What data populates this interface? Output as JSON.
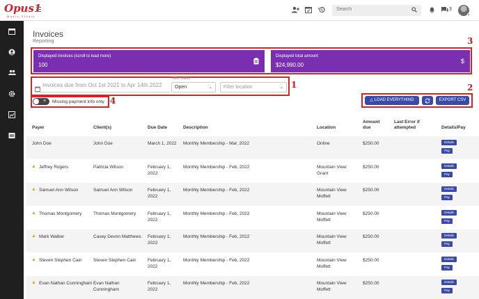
{
  "app": {
    "logo_text": "Opus1",
    "logo_subtitle": "Music Studio"
  },
  "topbar": {
    "search_placeholder": "Search",
    "chat_count": "3",
    "icons": [
      "person-add-icon",
      "calendar-check-icon",
      "history-icon",
      "bell-icon",
      "chat-icon"
    ]
  },
  "sidebar": {
    "icons": [
      "calendar-icon",
      "person-icon",
      "people-icon",
      "gear-icon",
      "chart-icon",
      "report-icon"
    ]
  },
  "page": {
    "title": "Invoices",
    "subtitle": "Reporting"
  },
  "cards": {
    "invoices_label": "Displayed invoices (scroll to load more)",
    "invoices_value": "100",
    "amount_label": "Displayed total amount",
    "amount_value": "$24,990.00"
  },
  "filters": {
    "date_range": "Invoices due from Oct 1st 2021 to Apr 14th 2022",
    "status_label": "Filter status",
    "status_value": "Open",
    "location_placeholder": "Filter location"
  },
  "toggle": {
    "label": "Missing payment info only"
  },
  "actions": {
    "load_everything": "LOAD EVERYTHING",
    "export_csv": "EXPORT CSV"
  },
  "annotations": [
    "1",
    "2",
    "3",
    "4"
  ],
  "colors": {
    "card_purple": "#7a2fb0",
    "button_blue": "#3a4aa8",
    "annotation_red": "#e02020",
    "warning": "#e8a317"
  },
  "table": {
    "headers": [
      "Payer",
      "Client(s)",
      "Due Date",
      "Description",
      "Location",
      "Amount due",
      "Last Error if attempted",
      "Details/Pay"
    ],
    "details_label": "Details",
    "pay_label": "Pay",
    "rows": [
      {
        "payer": "John Doe",
        "client": "John Doe",
        "due": "March 1, 2022",
        "desc": "Monthly Membership - Mar, 2022",
        "location": "Online",
        "amount": "$250.00",
        "warning": false
      },
      {
        "payer": "Jeffrey Rogers",
        "client": "Patricia Wilson",
        "due": "February 1, 2022",
        "desc": "Monthly Membership - Feb, 2022",
        "location": "Mountain View Grant",
        "amount": "$250.00",
        "warning": true
      },
      {
        "payer": "Samuel Ann Wilson",
        "client": "Samuel Ann Wilson",
        "due": "February 1, 2022",
        "desc": "Monthly Membership - Feb, 2022",
        "location": "Mountain View Moffett",
        "amount": "$250.00",
        "warning": true
      },
      {
        "payer": "Thomas Montgomery",
        "client": "Thomas Montgomery",
        "due": "February 1, 2022",
        "desc": "Monthly Membership - Feb, 2022",
        "location": "Mountain View Moffett",
        "amount": "$250.00",
        "warning": true
      },
      {
        "payer": "Mark Walker",
        "client": "Casey Devon Matthews",
        "due": "February 1, 2022",
        "desc": "Monthly Membership - Feb, 2022",
        "location": "Mountain View Moffett",
        "amount": "$250.00",
        "warning": true
      },
      {
        "payer": "Steven Stephen Cain",
        "client": "Steven Stephen Cain",
        "due": "February 1, 2022",
        "desc": "Monthly Membership - Feb, 2022",
        "location": "Mountain View Moffett",
        "amount": "$250.00",
        "warning": true
      },
      {
        "payer": "Evan Nathan Cunningham",
        "client": "Evan Nathan Cunningham",
        "due": "February 1, 2022",
        "desc": "Monthly Membership - Feb, 2022",
        "location": "Mountain View Moffett",
        "amount": "$250.00",
        "warning": true
      }
    ]
  }
}
